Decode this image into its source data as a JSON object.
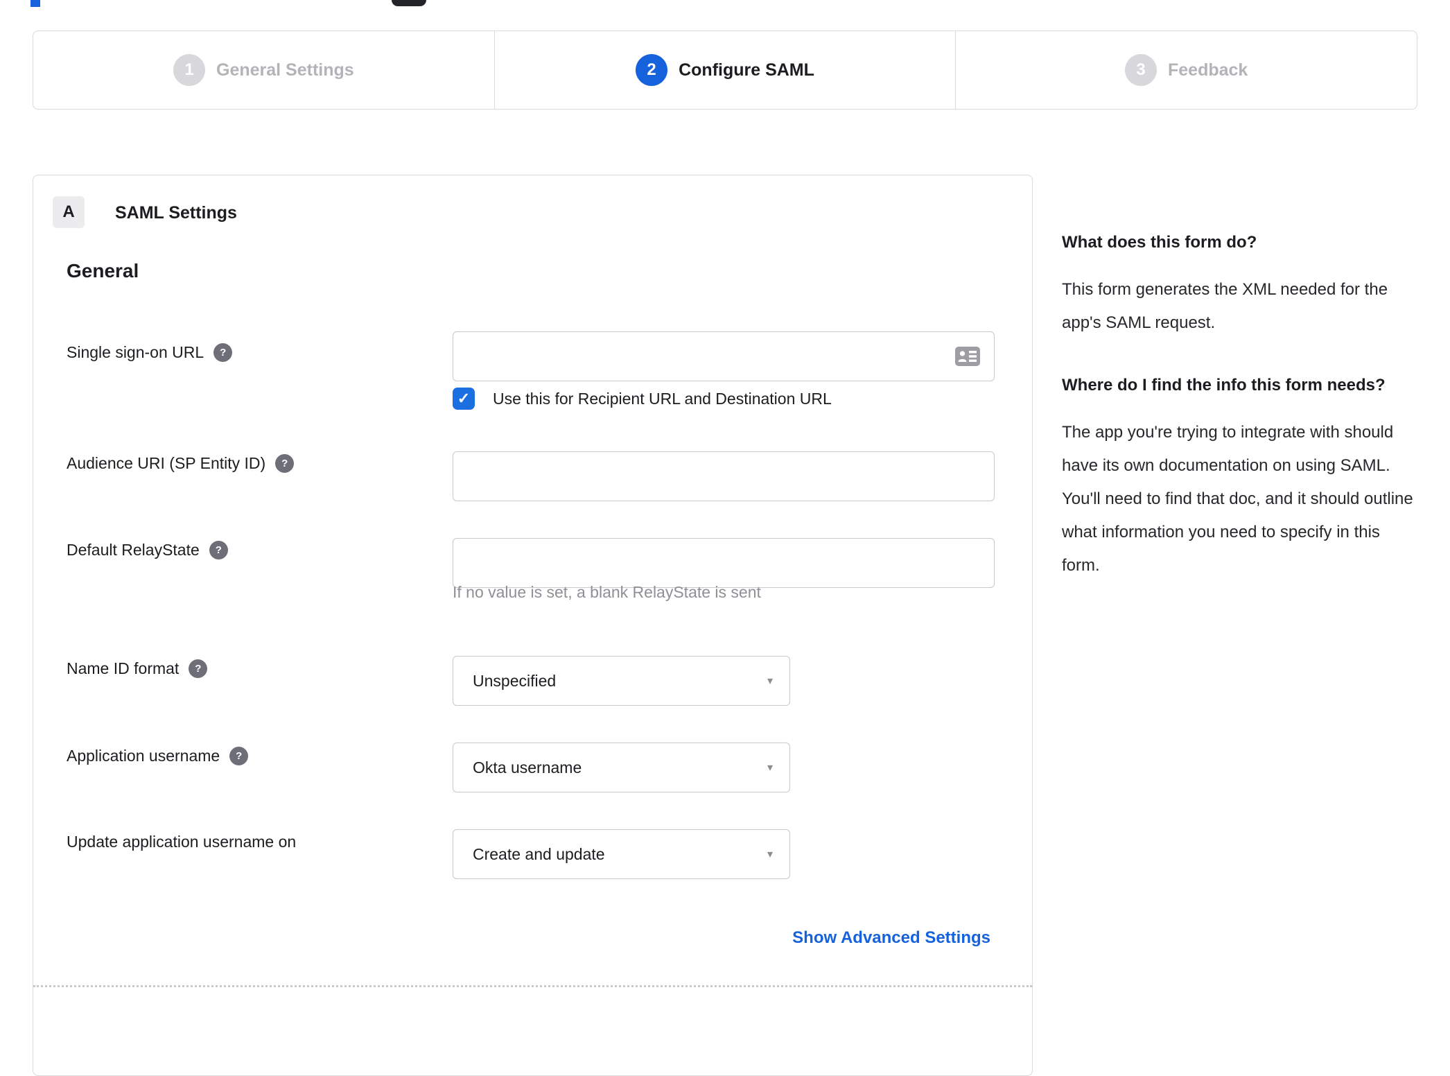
{
  "stepper": {
    "steps": [
      {
        "number": "1",
        "label": "General Settings",
        "state": "inactive"
      },
      {
        "number": "2",
        "label": "Configure SAML",
        "state": "active"
      },
      {
        "number": "3",
        "label": "Feedback",
        "state": "inactive"
      }
    ]
  },
  "panel": {
    "section_badge": "A",
    "section_title": "SAML Settings",
    "group_title": "General",
    "fields": {
      "sso_url": {
        "label": "Single sign-on URL",
        "value": "",
        "checkbox_label": "Use this for Recipient URL and Destination URL",
        "checkbox_checked": true
      },
      "audience_uri": {
        "label": "Audience URI (SP Entity ID)",
        "value": ""
      },
      "default_relaystate": {
        "label": "Default RelayState",
        "value": "",
        "helper": "If no value is set, a blank RelayState is sent"
      },
      "name_id_format": {
        "label": "Name ID format",
        "value": "Unspecified"
      },
      "app_username": {
        "label": "Application username",
        "value": "Okta username"
      },
      "update_app_username": {
        "label": "Update application username on",
        "value": "Create and update"
      }
    },
    "advanced_link": "Show Advanced Settings"
  },
  "sidebar": {
    "sections": [
      {
        "heading": "What does this form do?",
        "body": "This form generates the XML needed for the app's SAML request."
      },
      {
        "heading": "Where do I find the info this form needs?",
        "body": "The app you're trying to integrate with should have its own documentation on using SAML. You'll need to find that doc, and it should outline what information you need to specify in this form."
      }
    ]
  },
  "icons": {
    "help": "?",
    "check": "✓",
    "caret": "▾"
  },
  "colors": {
    "accent_blue": "#1662dd",
    "inactive_gray": "#d8d8dc",
    "border_gray": "#d9d9de",
    "text_dark": "#1d1d21",
    "helper_gray": "#8f8f96"
  }
}
